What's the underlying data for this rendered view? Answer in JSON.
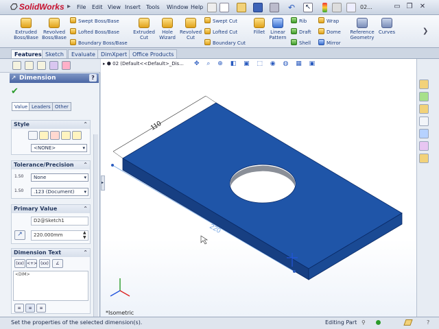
{
  "app": {
    "logo": "SolidWorks",
    "window_title": "02..."
  },
  "menu": [
    "File",
    "Edit",
    "View",
    "Insert",
    "Tools",
    "Window",
    "Help"
  ],
  "ribbon": {
    "extruded_boss": "Extruded Boss/Base",
    "revolved_boss": "Revolved Boss/Base",
    "swept_boss": "Swept Boss/Base",
    "lofted_boss": "Lofted Boss/Base",
    "boundary_boss": "Boundary Boss/Base",
    "extruded_cut": "Extruded Cut",
    "hole_wizard": "Hole Wizard",
    "revolved_cut": "Revolved Cut",
    "swept_cut": "Swept Cut",
    "lofted_cut": "Lofted Cut",
    "boundary_cut": "Boundary Cut",
    "fillet": "Fillet",
    "linear_pattern": "Linear Pattern",
    "rib": "Rib",
    "draft": "Draft",
    "shell": "Shell",
    "wrap": "Wrap",
    "dome": "Dome",
    "mirror": "Mirror",
    "reference_geometry": "Reference Geometry",
    "curves": "Curves"
  },
  "tabs": [
    "Features",
    "Sketch",
    "Evaluate",
    "DimXpert",
    "Office Products"
  ],
  "active_tab": "Features",
  "panel": {
    "title": "Dimension",
    "help": "?",
    "subtabs": [
      "Value",
      "Leaders",
      "Other"
    ],
    "style": {
      "header": "Style",
      "value": "<NONE>"
    },
    "tolerance": {
      "header": "Tolerance/Precision",
      "type": "None",
      "precision": ".123 (Document)",
      "tol_icon": "1.50",
      "prec_icon": "1.50"
    },
    "primary": {
      "header": "Primary Value",
      "name": "D2@Sketch1",
      "value": "220.000mm"
    },
    "dimtext": {
      "header": "Dimension Text",
      "text": "<DIM>",
      "buttons": [
        "(xx)",
        "<+>",
        "(xx)",
        "∠"
      ]
    }
  },
  "viewport": {
    "tree_label": "02  (Default<<Default>_Dis...",
    "dim_width": "110",
    "dim_length": "220",
    "view_name": "*Isometric",
    "part_color": "#1f55a8"
  },
  "status": {
    "hint": "Set the properties of the selected dimension(s).",
    "mode": "Editing Part"
  }
}
